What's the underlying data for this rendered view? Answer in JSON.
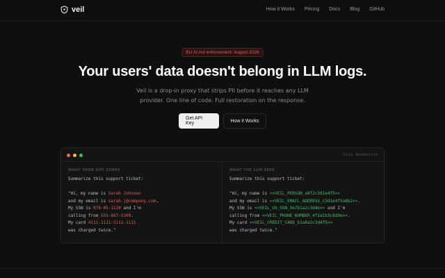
{
  "nav": {
    "brand": "veil",
    "links": [
      "How it Works",
      "Pricing",
      "Docs",
      "Blog",
      "GitHub"
    ]
  },
  "hero": {
    "badge": "EU AI Act enforcement: August 2026",
    "headline": "Your users' data doesn't belong in LLM logs.",
    "sub_line1": "Veil is a drop-in proxy that strips PII before it reaches any LLM",
    "sub_line2": "provider. One line of code. Full restoration on the response.",
    "cta_primary": "Get API Key",
    "cta_secondary": "How it Works"
  },
  "demo": {
    "title": "Live Redaction",
    "left": {
      "heading": "WHAT YOUR APP SENDS",
      "line1": "Summarize this support ticket:",
      "l1a": "\"Hi, my name is ",
      "l1b": "Sarah Johnson",
      "l2a": "and my email is ",
      "l2b": "sarah.j@company.com",
      "l2c": ".",
      "l3a": "My SSN is ",
      "l3b": "078-05-1120",
      "l3c": " and I'm",
      "l4a": "calling from ",
      "l4b": "555-867-5309",
      "l4c": ".",
      "l5a": "My card ",
      "l5b": "4111-1111-1111-1111",
      "l6": "was charged twice.\""
    },
    "right": {
      "heading": "WHAT THE LLM SEES",
      "line1": "Summarize this support ticket:",
      "l1a": "\"Hi, my name is ",
      "l1b": "<<VEIL_PERSON_a8f2c3d1e4f5>>",
      "l2a": "and my email is ",
      "l2b": "<<VEIL_EMAIL_ADDRESS_c3d1e4f5a8b2>>",
      "l2c": ".",
      "l3a": "My SSN is ",
      "l3b": "<<VEIL_US_SSN_9e7b1a2c3d4e>>",
      "l3c": " and I'm",
      "l4a": "calling from ",
      "l4b": "<<VEIL_PHONE_NUMBER_4f2a1b3c8d9e>>",
      "l4c": ".",
      "l5a": "My card ",
      "l5b": "<<VEIL_CREDIT_CARD_b1a8a2c3d4f5>>",
      "l6": "was charged twice.\""
    }
  },
  "colors": {
    "background": "#0f0f0f",
    "pii_highlight": "#e0605c",
    "token_highlight": "#3fbf6a",
    "badge_text": "#e05b5b"
  }
}
